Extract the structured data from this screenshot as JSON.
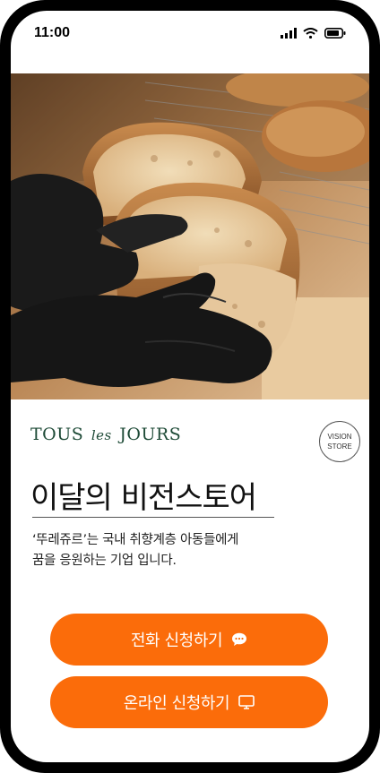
{
  "status_bar": {
    "time": "11:00"
  },
  "brand": {
    "logo_part1": "TOUS",
    "logo_part2": "les",
    "logo_part3": "JOURS",
    "badge_line1": "VISION",
    "badge_line2": "STORE"
  },
  "main": {
    "title": "이달의 비전스토어",
    "description_line1": "‘뚜레쥬르’는 국내 취향계층 아동들에게",
    "description_line2": "꿈을 응원하는 기업 입니다."
  },
  "buttons": {
    "call_label": "전화 신청하기",
    "online_label": "온라인 신청하기"
  },
  "colors": {
    "accent": "#fb6c0a",
    "brand_green": "#1d4a36"
  },
  "icons": {
    "call": "chat-bubble-icon",
    "online": "monitor-icon"
  }
}
